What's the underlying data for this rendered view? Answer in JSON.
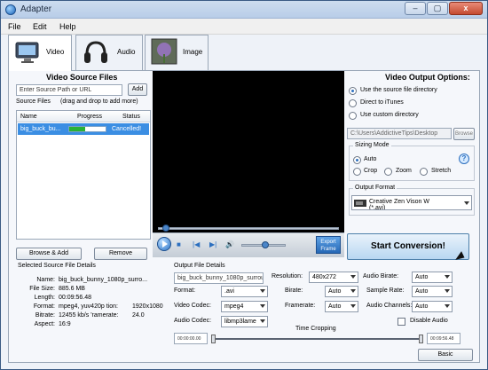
{
  "window": {
    "title": "Adapter",
    "close": "x",
    "minimize": "–",
    "maximize": "▢"
  },
  "menu": [
    "File",
    "Edit",
    "Help"
  ],
  "tabs": [
    {
      "label": "Video",
      "icon": "monitor-icon"
    },
    {
      "label": "Audio",
      "icon": "headphones-icon"
    },
    {
      "label": "Image",
      "icon": "image-icon"
    }
  ],
  "source": {
    "title": "Video Source Files",
    "input_placeholder": "Enter Source Path or URL",
    "add": "Add",
    "source_files_label": "Source Files",
    "hint": "(drag and drop to add more)",
    "columns": [
      "Name",
      "Progress",
      "Status"
    ],
    "rows": [
      {
        "name": "big_buck_bu...",
        "progress": 45,
        "status": "Cancelled!"
      }
    ],
    "browse_add": "Browse & Add",
    "remove": "Remove"
  },
  "player": {
    "export_line1": "Export",
    "export_line2": "Frame",
    "position": 4,
    "volume": 55
  },
  "output_options": {
    "title": "Video Output Options:",
    "radio": [
      "Use the source file directory",
      "Direct to iTunes",
      "Use custom directory"
    ],
    "path": "C:\\Users\\AddictiveTips\\Desktop",
    "browse": "Browse"
  },
  "sizing": {
    "title": "Sizing Mode",
    "options": [
      "Auto",
      "Crop",
      "Zoom",
      "Stretch"
    ],
    "help": "?"
  },
  "format": {
    "title": "Output Format",
    "selected_line1": "Creative Zen Vison W",
    "selected_line2": "(*.avi)"
  },
  "start": "Start Conversion!",
  "selected": {
    "title": "Selected Source File Details",
    "fields": [
      {
        "label": "Name:",
        "value": "big_buck_bunny_1080p_surro..."
      },
      {
        "label": "File Size:",
        "value": "885.6 MB"
      },
      {
        "label": "Length:",
        "value": "00:09:56.48"
      },
      {
        "label": "Format:",
        "value": "mpeg4, yuv420p tion:",
        "extra": "1920x1080"
      },
      {
        "label": "Bitrate:",
        "value": "12455 kb/s 'ramerate:",
        "extra": "24.0"
      },
      {
        "label": "Aspect:",
        "value": "16:9"
      }
    ]
  },
  "output_details": {
    "title": "Output File Details",
    "filename": "big_buck_bunny_1080p_surrou",
    "resolution_label": "Resolution:",
    "resolution": "480x272",
    "audio_bitrate_label": "Audio Birate:",
    "audio_bitrate": "Auto",
    "format_label": "Format:",
    "format": ".avi",
    "bitrate_label": "Birate:",
    "bitrate": "Auto",
    "sample_rate_label": "Sample Rate:",
    "sample_rate": "Auto",
    "video_codec_label": "Video Codec:",
    "video_codec": "mpeg4",
    "framerate_label": "Framerate:",
    "framerate": "Auto",
    "audio_channels_label": "Audio Channels:",
    "audio_channels": "Auto",
    "audio_codec_label": "Audio Codec:",
    "audio_codec": "libmp3lame",
    "disable_audio": "Disable Audio",
    "time_cropping": "Time Cropping",
    "crop_start": "00:00:00.00",
    "crop_end": "00:09:56.48"
  },
  "basic": "Basic"
}
